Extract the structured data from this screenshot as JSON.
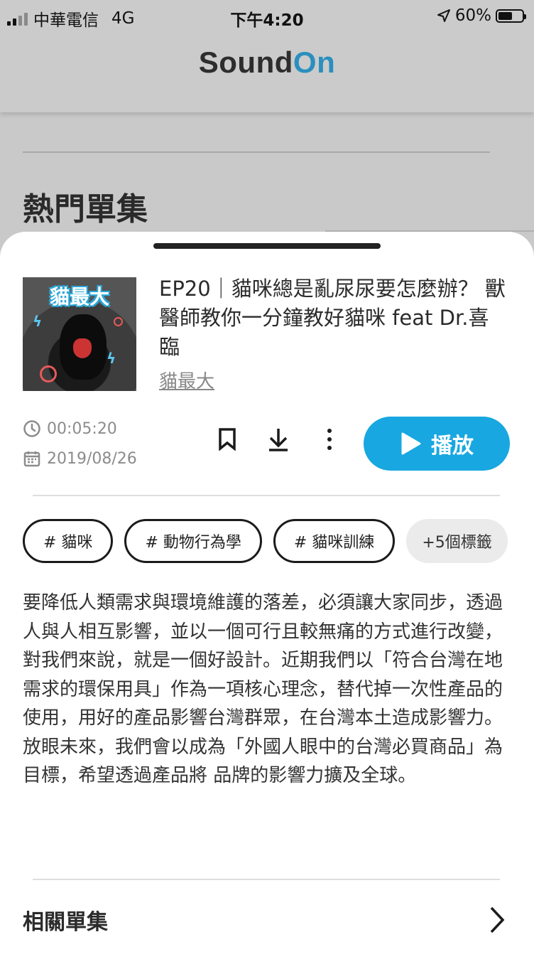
{
  "status_bar": {
    "carrier": "中華電信",
    "network": "4G",
    "time": "下午4:20",
    "battery_text": "60%",
    "battery_level": 0.6
  },
  "header": {
    "logo_part1": "Sound",
    "logo_part2": "On",
    "colors": {
      "logo_dark": "#2d2d2d",
      "logo_accent": "#2a8fbf"
    }
  },
  "background_page": {
    "section_title": "熱門單集"
  },
  "episode": {
    "cover_title": "貓最大",
    "title": "EP20｜貓咪總是亂尿尿要怎麼辦？ 獸醫師教你一分鐘教好貓咪 feat Dr.喜臨",
    "author": "貓最大",
    "duration": "00:05:20",
    "date": "2019/08/26",
    "play_label": "播放",
    "accent_color": "#18a7e0",
    "icons": [
      "clock-icon",
      "calendar-icon",
      "bookmark-icon",
      "download-icon",
      "more-icon",
      "play-icon",
      "chevron-right-icon"
    ]
  },
  "tags": [
    {
      "label": "# 貓咪"
    },
    {
      "label": "# 動物行為學"
    },
    {
      "label": "# 貓咪訓練"
    }
  ],
  "more_tags_label": "+5個標籤",
  "description": "要降低人類需求與環境維護的落差，必須讓大家同步，透過人與人相互影響，並以一個可行且較無痛的方式進行改變，對我們來說，就是一個好設計。近期我們以「符合台灣在地需求的環保用具」作為一項核心理念，替代掉一次性產品的使用，用好的產品影響台灣群眾，在台灣本土造成影響力。放眼未來，我們會以成為「外國人眼中的台灣必買商品」為目標，希望透過產品將 品牌的影響力擴及全球。",
  "related": {
    "label": "相關單集"
  }
}
